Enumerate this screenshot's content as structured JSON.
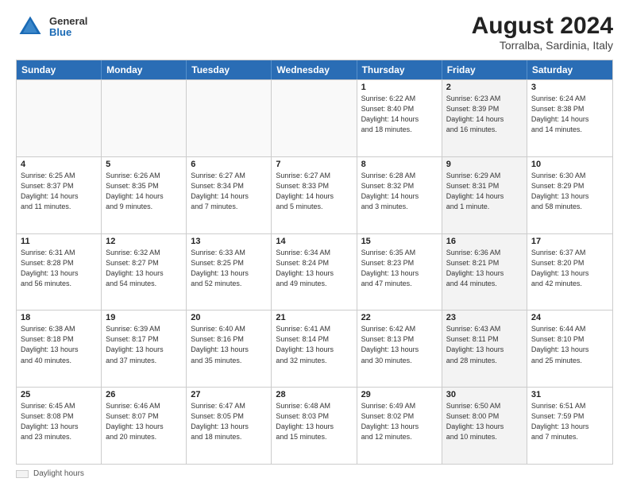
{
  "logo": {
    "general": "General",
    "blue": "Blue"
  },
  "title": {
    "month_year": "August 2024",
    "location": "Torralba, Sardinia, Italy"
  },
  "days_of_week": [
    "Sunday",
    "Monday",
    "Tuesday",
    "Wednesday",
    "Thursday",
    "Friday",
    "Saturday"
  ],
  "legend": {
    "label": "Daylight hours"
  },
  "weeks": [
    [
      {
        "day": "",
        "info": ""
      },
      {
        "day": "",
        "info": ""
      },
      {
        "day": "",
        "info": ""
      },
      {
        "day": "",
        "info": ""
      },
      {
        "day": "1",
        "info": "Sunrise: 6:22 AM\nSunset: 8:40 PM\nDaylight: 14 hours\nand 18 minutes."
      },
      {
        "day": "2",
        "info": "Sunrise: 6:23 AM\nSunset: 8:39 PM\nDaylight: 14 hours\nand 16 minutes."
      },
      {
        "day": "3",
        "info": "Sunrise: 6:24 AM\nSunset: 8:38 PM\nDaylight: 14 hours\nand 14 minutes."
      }
    ],
    [
      {
        "day": "4",
        "info": "Sunrise: 6:25 AM\nSunset: 8:37 PM\nDaylight: 14 hours\nand 11 minutes."
      },
      {
        "day": "5",
        "info": "Sunrise: 6:26 AM\nSunset: 8:35 PM\nDaylight: 14 hours\nand 9 minutes."
      },
      {
        "day": "6",
        "info": "Sunrise: 6:27 AM\nSunset: 8:34 PM\nDaylight: 14 hours\nand 7 minutes."
      },
      {
        "day": "7",
        "info": "Sunrise: 6:27 AM\nSunset: 8:33 PM\nDaylight: 14 hours\nand 5 minutes."
      },
      {
        "day": "8",
        "info": "Sunrise: 6:28 AM\nSunset: 8:32 PM\nDaylight: 14 hours\nand 3 minutes."
      },
      {
        "day": "9",
        "info": "Sunrise: 6:29 AM\nSunset: 8:31 PM\nDaylight: 14 hours\nand 1 minute."
      },
      {
        "day": "10",
        "info": "Sunrise: 6:30 AM\nSunset: 8:29 PM\nDaylight: 13 hours\nand 58 minutes."
      }
    ],
    [
      {
        "day": "11",
        "info": "Sunrise: 6:31 AM\nSunset: 8:28 PM\nDaylight: 13 hours\nand 56 minutes."
      },
      {
        "day": "12",
        "info": "Sunrise: 6:32 AM\nSunset: 8:27 PM\nDaylight: 13 hours\nand 54 minutes."
      },
      {
        "day": "13",
        "info": "Sunrise: 6:33 AM\nSunset: 8:25 PM\nDaylight: 13 hours\nand 52 minutes."
      },
      {
        "day": "14",
        "info": "Sunrise: 6:34 AM\nSunset: 8:24 PM\nDaylight: 13 hours\nand 49 minutes."
      },
      {
        "day": "15",
        "info": "Sunrise: 6:35 AM\nSunset: 8:23 PM\nDaylight: 13 hours\nand 47 minutes."
      },
      {
        "day": "16",
        "info": "Sunrise: 6:36 AM\nSunset: 8:21 PM\nDaylight: 13 hours\nand 44 minutes."
      },
      {
        "day": "17",
        "info": "Sunrise: 6:37 AM\nSunset: 8:20 PM\nDaylight: 13 hours\nand 42 minutes."
      }
    ],
    [
      {
        "day": "18",
        "info": "Sunrise: 6:38 AM\nSunset: 8:18 PM\nDaylight: 13 hours\nand 40 minutes."
      },
      {
        "day": "19",
        "info": "Sunrise: 6:39 AM\nSunset: 8:17 PM\nDaylight: 13 hours\nand 37 minutes."
      },
      {
        "day": "20",
        "info": "Sunrise: 6:40 AM\nSunset: 8:16 PM\nDaylight: 13 hours\nand 35 minutes."
      },
      {
        "day": "21",
        "info": "Sunrise: 6:41 AM\nSunset: 8:14 PM\nDaylight: 13 hours\nand 32 minutes."
      },
      {
        "day": "22",
        "info": "Sunrise: 6:42 AM\nSunset: 8:13 PM\nDaylight: 13 hours\nand 30 minutes."
      },
      {
        "day": "23",
        "info": "Sunrise: 6:43 AM\nSunset: 8:11 PM\nDaylight: 13 hours\nand 28 minutes."
      },
      {
        "day": "24",
        "info": "Sunrise: 6:44 AM\nSunset: 8:10 PM\nDaylight: 13 hours\nand 25 minutes."
      }
    ],
    [
      {
        "day": "25",
        "info": "Sunrise: 6:45 AM\nSunset: 8:08 PM\nDaylight: 13 hours\nand 23 minutes."
      },
      {
        "day": "26",
        "info": "Sunrise: 6:46 AM\nSunset: 8:07 PM\nDaylight: 13 hours\nand 20 minutes."
      },
      {
        "day": "27",
        "info": "Sunrise: 6:47 AM\nSunset: 8:05 PM\nDaylight: 13 hours\nand 18 minutes."
      },
      {
        "day": "28",
        "info": "Sunrise: 6:48 AM\nSunset: 8:03 PM\nDaylight: 13 hours\nand 15 minutes."
      },
      {
        "day": "29",
        "info": "Sunrise: 6:49 AM\nSunset: 8:02 PM\nDaylight: 13 hours\nand 12 minutes."
      },
      {
        "day": "30",
        "info": "Sunrise: 6:50 AM\nSunset: 8:00 PM\nDaylight: 13 hours\nand 10 minutes."
      },
      {
        "day": "31",
        "info": "Sunrise: 6:51 AM\nSunset: 7:59 PM\nDaylight: 13 hours\nand 7 minutes."
      }
    ]
  ]
}
